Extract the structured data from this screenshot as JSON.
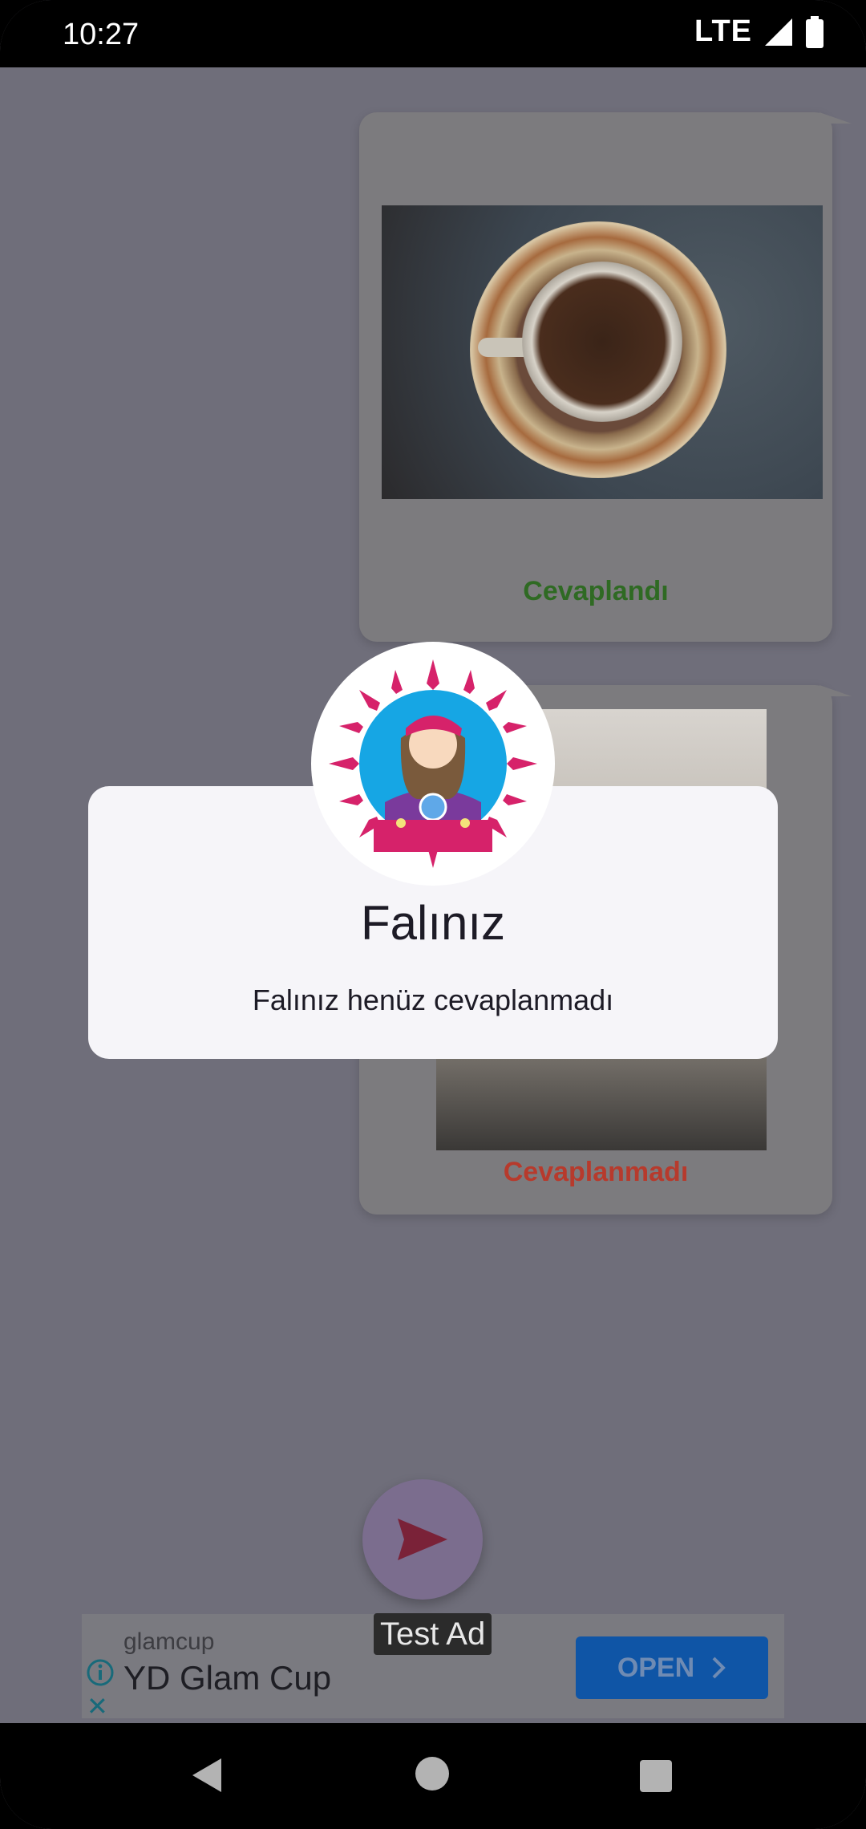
{
  "status_bar": {
    "time": "10:27",
    "network": "LTE"
  },
  "cards": [
    {
      "status": "Cevaplandı",
      "status_color": "#2f6a23"
    },
    {
      "status": "Cevaplanmadı",
      "status_color": "#b73a2c"
    }
  ],
  "fab": {
    "icon": "send-icon"
  },
  "ad": {
    "badge": "Test Ad",
    "brand": "glamcup",
    "title": "YD Glam Cup",
    "button": "OPEN"
  },
  "dialog": {
    "title": "Falınız",
    "message": "Falınız henüz cevaplanmadı",
    "avatar_icon": "fortune-teller-icon"
  },
  "nav": {
    "back": "back-icon",
    "home": "home-icon",
    "recent": "recents-icon"
  }
}
